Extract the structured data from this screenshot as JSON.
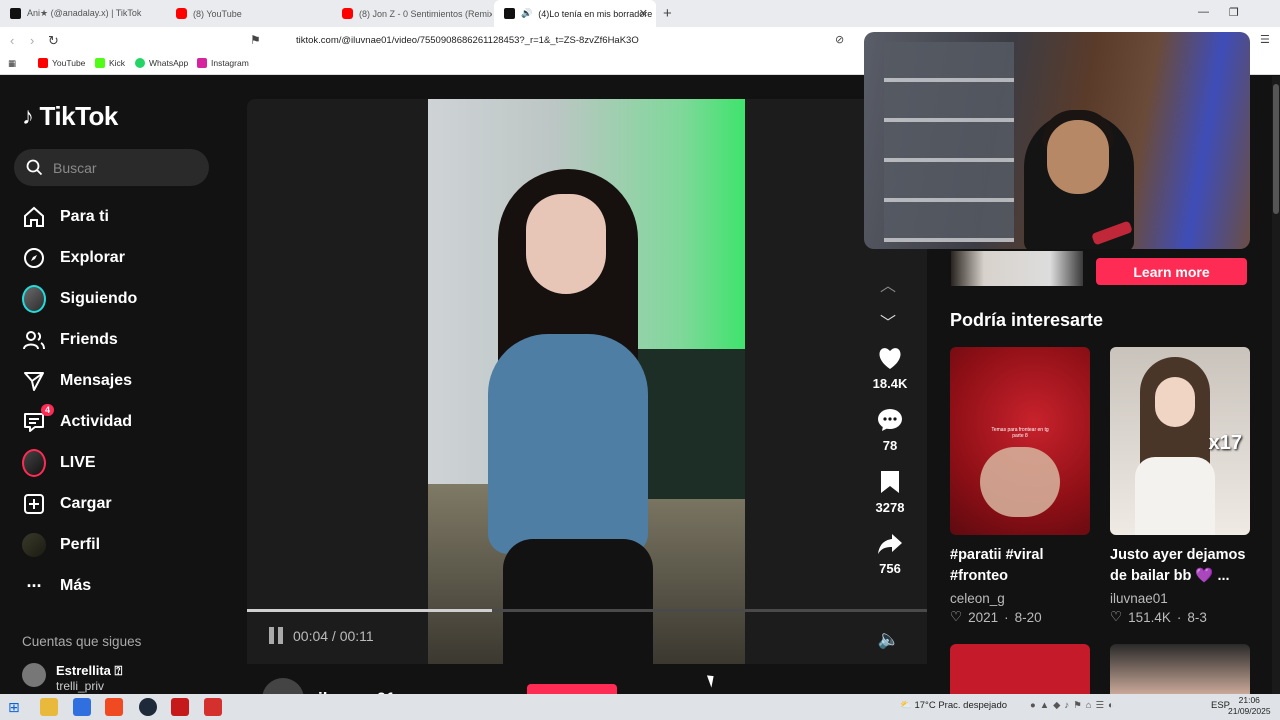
{
  "browser": {
    "tabs": [
      {
        "label": "Ani★ (@anadalay.x) | TikTok",
        "icon": "tiktok-icon"
      },
      {
        "label": "(8) YouTube",
        "icon": "youtube-icon"
      },
      {
        "label": "(8) Jon Z - 0 Sentimientos (Remix) ft.",
        "icon": "youtube-icon"
      },
      {
        "label": "(4)Lo tenía en mis borradore",
        "icon": "tiktok-icon",
        "active": true
      }
    ],
    "url": "tiktok.com/@iluvnae01/video/7550908686261128453?_r=1&_t=ZS-8zvZf6HaK3O",
    "bookmarks": [
      {
        "label": "YouTube",
        "color": "#ff0000"
      },
      {
        "label": "Kick",
        "color": "#53fc18"
      },
      {
        "label": "WhatsApp",
        "color": "#25d366"
      },
      {
        "label": "Instagram",
        "color": "#d6249f"
      }
    ]
  },
  "sidebar": {
    "logo": "TikTok",
    "search_placeholder": "Buscar",
    "nav": [
      {
        "label": "Para ti",
        "icon": "home-icon"
      },
      {
        "label": "Explorar",
        "icon": "compass-icon"
      },
      {
        "label": "Siguiendo",
        "icon": "following-avatar-icon"
      },
      {
        "label": "Friends",
        "icon": "friends-icon"
      },
      {
        "label": "Mensajes",
        "icon": "send-icon"
      },
      {
        "label": "Actividad",
        "icon": "activity-icon",
        "badge": "4"
      },
      {
        "label": "LIVE",
        "icon": "live-icon"
      },
      {
        "label": "Cargar",
        "icon": "upload-icon"
      },
      {
        "label": "Perfil",
        "icon": "profile-icon"
      },
      {
        "label": "Más",
        "icon": "more-icon"
      }
    ],
    "following_header": "Cuentas que sigues",
    "following": [
      {
        "name": "Estrellita ⍰",
        "handle": "trelli_priv"
      }
    ]
  },
  "player": {
    "current_time": "00:04",
    "duration": "00:11",
    "time_display": "00:04 / 00:11",
    "progress": 0.36,
    "author": "iluvnae01"
  },
  "actions": {
    "likes": "18.4K",
    "comments": "78",
    "saves": "3278",
    "shares": "756"
  },
  "right": {
    "ad_button": "Learn more",
    "recommend_header": "Podría interesarte",
    "cards": [
      {
        "title": "#paratii #viral #fronteo",
        "user": "celeon_g",
        "likes": "2021",
        "date": "8-20",
        "thumb_text": "Temas para frontear en tg parte 8"
      },
      {
        "title": "Justo ayer dejamos de bailar bb 💜 ...",
        "user": "iluvnae01",
        "likes": "151.4K",
        "date": "8-3",
        "thumb_text": "x17"
      }
    ]
  },
  "taskbar": {
    "weather": "17°C  Prac. despejado",
    "lang": "ESP",
    "time": "21:06",
    "date": "21/09/2025"
  },
  "colors": {
    "accent": "#fe2c55",
    "bg": "#121212"
  }
}
